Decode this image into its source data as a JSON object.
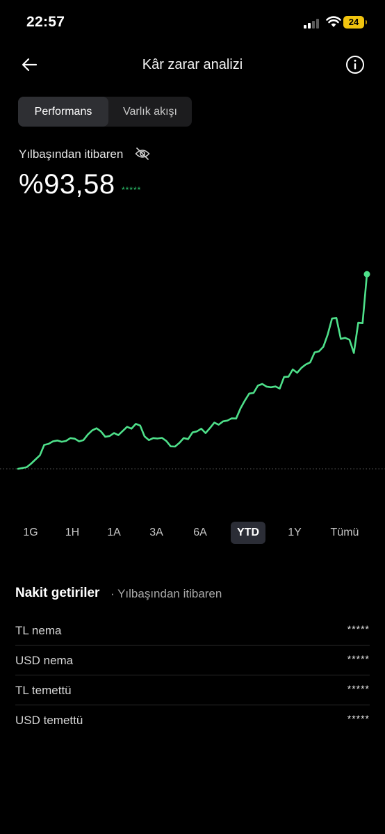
{
  "status_bar": {
    "time": "22:57",
    "battery": "24"
  },
  "header": {
    "title": "Kâr zarar analizi",
    "back_icon": "arrow-left-icon",
    "info_icon": "info-circle-icon"
  },
  "segments": [
    {
      "label": "Performans",
      "active": true
    },
    {
      "label": "Varlık akışı",
      "active": false
    }
  ],
  "performance": {
    "period_label": "Yılbaşından itibaren",
    "value": "%93,58",
    "hidden_amount": "*****",
    "eye_icon": "eye-slash-icon"
  },
  "chart_data": {
    "type": "line",
    "title": "",
    "xlabel": "",
    "ylabel": "",
    "color": "#4ee08a",
    "baseline_dotted": true,
    "x": [
      0,
      1,
      2,
      3,
      4,
      5,
      6,
      7,
      8,
      9,
      10,
      11,
      12,
      13,
      14,
      15,
      16,
      17,
      18,
      19,
      20,
      21,
      22,
      23,
      24,
      25,
      26,
      27,
      28,
      29,
      30,
      31,
      32,
      33,
      34,
      35,
      36,
      37,
      38,
      39,
      40,
      41,
      42,
      43,
      44,
      45,
      46,
      47,
      48,
      49,
      50,
      51,
      52,
      53,
      54,
      55,
      56,
      57,
      58,
      59,
      60,
      61,
      62,
      63,
      64,
      65,
      66,
      67,
      68,
      69,
      70,
      71,
      72,
      73,
      74,
      75,
      76,
      77,
      78,
      79,
      80,
      81,
      82,
      83,
      84,
      85,
      86,
      87,
      88,
      89,
      90,
      91,
      92,
      93,
      94,
      95,
      96,
      97,
      98,
      99
    ],
    "values": [
      0,
      0.4,
      0.8,
      2.5,
      4.5,
      6.5,
      11.5,
      12,
      13.2,
      13.6,
      13,
      13.4,
      14.8,
      14.5,
      13.2,
      13.8,
      16.5,
      18.5,
      19.5,
      18,
      15.4,
      15.8,
      17.2,
      16.2,
      18.2,
      20.2,
      19.3,
      21.6,
      20.8,
      15.6,
      13.8,
      14.8,
      14.6,
      14.9,
      13.4,
      10.8,
      10.7,
      12.5,
      14.8,
      14.3,
      17.5,
      18,
      19.3,
      17.2,
      19.6,
      22.2,
      21.2,
      22.8,
      23.2,
      24.3,
      24.2,
      29,
      32.8,
      36.2,
      36.5,
      40,
      40.8,
      39.5,
      39.2,
      39.6,
      38.6,
      44.2,
      44.3,
      47.8,
      46.2,
      48.6,
      50.2,
      51.2,
      56,
      56.5,
      58.7,
      64.5,
      72.3,
      72.5,
      62.5,
      63,
      62.1,
      55.7,
      70.2,
      70,
      93.6
    ],
    "ylim": [
      0,
      95
    ],
    "grid": false,
    "legend": "none"
  },
  "periods": [
    {
      "label": "1G",
      "active": false
    },
    {
      "label": "1H",
      "active": false
    },
    {
      "label": "1A",
      "active": false
    },
    {
      "label": "3A",
      "active": false
    },
    {
      "label": "6A",
      "active": false
    },
    {
      "label": "YTD",
      "active": true
    },
    {
      "label": "1Y",
      "active": false
    },
    {
      "label": "Tümü",
      "active": false
    }
  ],
  "cash_returns": {
    "title": "Nakit getiriler",
    "subtitle": "· Yılbaşından itibaren",
    "rows": [
      {
        "label": "TL nema",
        "value": "*****"
      },
      {
        "label": "USD nema",
        "value": "*****"
      },
      {
        "label": "TL temettü",
        "value": "*****"
      },
      {
        "label": "USD temettü",
        "value": "*****"
      }
    ]
  }
}
